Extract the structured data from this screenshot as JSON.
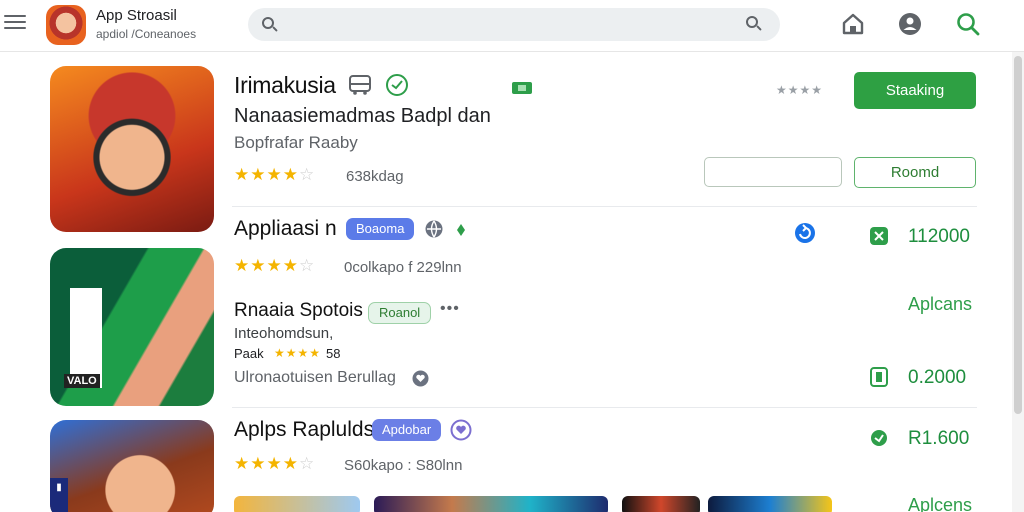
{
  "header": {
    "brand_title": "App Stroasil",
    "brand_sub": "apdiol /Coneanoes",
    "search_placeholder": ""
  },
  "featured": {
    "title": "Irimakusia",
    "subtitle": "Nanaasiemadmas Badpl dan",
    "developer": "Bopfrafar Raaby",
    "rating_text": "638kdag",
    "rating_value": 4,
    "rating_max": 5,
    "primary_button": "Staaking",
    "secondary_button": "Roomd",
    "rank_text": "★★★★"
  },
  "list": [
    {
      "title": "Appliaasi n",
      "badge": "Boaoma",
      "rating_value": 4,
      "meta": "0colkapo f 229lnn",
      "price": "112000"
    },
    {
      "title": "Rnaaia Spotois",
      "badge": "Roanol",
      "more": "•••",
      "line1": "Inteohomdsun,",
      "line2_prefix": "Paak",
      "line2_suffix": "58",
      "rating_value": 4,
      "line3": "Ulronaotuisen Berullag",
      "side_label": "Aplcans",
      "price": "0.2000"
    },
    {
      "title": "Aplps Raplulds",
      "badge": "Apdobar",
      "rating_value": 4,
      "meta": "S60kapo : S80lnn",
      "price": "R1.600",
      "side_label": "Aplcens"
    }
  ],
  "colors": {
    "accent_green": "#2ea043",
    "star": "#f4b400",
    "badge_blue": "#5b7be8"
  },
  "icons": {
    "menu": "hamburger-icon",
    "search": "search-icon",
    "home": "home-icon",
    "account": "account-icon",
    "search_green": "search-icon-green"
  }
}
